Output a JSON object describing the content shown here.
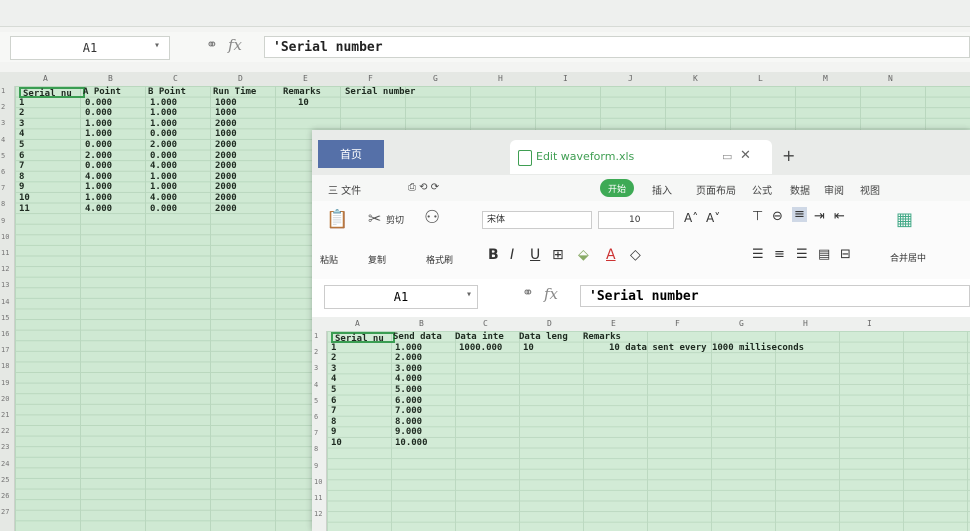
{
  "background": {
    "name_box": "A1",
    "formula": "'Serial number",
    "col_headers": [
      "A",
      "B",
      "C",
      "D",
      "E",
      "F",
      "G",
      "H",
      "I",
      "J",
      "K",
      "L",
      "M",
      "N"
    ],
    "headers": [
      "Serial nu",
      "A Point",
      "B Point",
      "Run Time",
      "Remarks"
    ],
    "remark": "Serial number",
    "row_labels": [
      "1",
      "2",
      "3",
      "4",
      "5",
      "6",
      "7",
      "8",
      "9",
      "10",
      "11",
      "12",
      "13",
      "14",
      "15",
      "16",
      "17",
      "18",
      "19",
      "20",
      "21",
      "22",
      "23",
      "24",
      "25",
      "26",
      "27"
    ],
    "rows": [
      [
        "1",
        "0.000",
        "1.000",
        "1000"
      ],
      [
        "2",
        "0.000",
        "1.000",
        "1000"
      ],
      [
        "3",
        "1.000",
        "1.000",
        "2000"
      ],
      [
        "4",
        "1.000",
        "0.000",
        "1000"
      ],
      [
        "5",
        "0.000",
        "2.000",
        "2000"
      ],
      [
        "6",
        "2.000",
        "0.000",
        "2000"
      ],
      [
        "7",
        "0.000",
        "4.000",
        "2000"
      ],
      [
        "8",
        "4.000",
        "1.000",
        "2000"
      ],
      [
        "9",
        "1.000",
        "1.000",
        "2000"
      ],
      [
        "10",
        "1.000",
        "4.000",
        "2000"
      ],
      [
        "11",
        "4.000",
        "0.000",
        "2000"
      ]
    ],
    "run_time_extra": "10"
  },
  "window": {
    "home_tab": "首页",
    "doc_title": "Edit waveform.xls",
    "menu": [
      "三 文件",
      "开始",
      "插入",
      "页面布局",
      "公式",
      "数据",
      "审阅",
      "视图"
    ],
    "ribbon": {
      "paste": "粘贴",
      "cut": "剪切",
      "copy": "复制",
      "format_painter": "格式刷",
      "font": "宋体",
      "size": "10",
      "merge": "合并居中"
    },
    "name_box": "A1",
    "formula": "'Serial number",
    "col_headers": [
      "A",
      "B",
      "C",
      "D",
      "E",
      "F",
      "G",
      "H",
      "I"
    ],
    "headers": [
      "Serial nu",
      "Send data",
      "Data inte",
      "Data leng",
      "Remarks"
    ],
    "first_interval": "1000.000",
    "first_length": "10",
    "remark": "10 data sent every 1000 milliseconds",
    "row_labels": [
      "1",
      "2",
      "3",
      "4",
      "5",
      "6",
      "7",
      "8",
      "9",
      "10",
      "11",
      "12"
    ],
    "rows": [
      [
        "1",
        "1.000"
      ],
      [
        "2",
        "2.000"
      ],
      [
        "3",
        "3.000"
      ],
      [
        "4",
        "4.000"
      ],
      [
        "5",
        "5.000"
      ],
      [
        "6",
        "6.000"
      ],
      [
        "7",
        "7.000"
      ],
      [
        "8",
        "8.000"
      ],
      [
        "9",
        "9.000"
      ],
      [
        "10",
        "10.000"
      ]
    ]
  }
}
